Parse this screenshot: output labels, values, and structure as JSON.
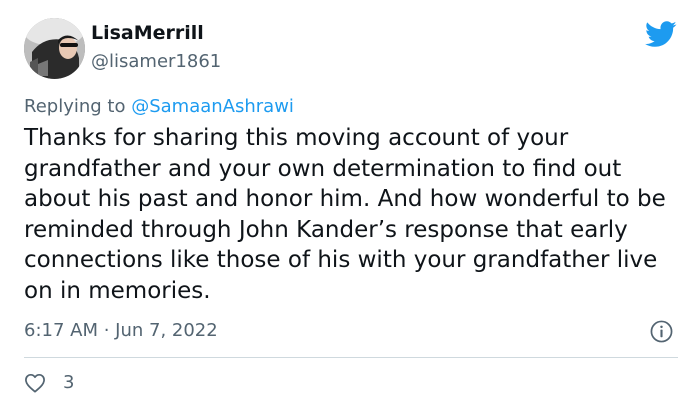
{
  "author": {
    "display_name": "LisaMerrill",
    "handle": "@lisamer1861"
  },
  "reply": {
    "prefix": "Replying to ",
    "mention": "@SamaanAshrawi"
  },
  "tweet": {
    "text": "Thanks for sharing this moving account of your grandfather and your own determination to find out about his past and honor him. And how wonderful to be reminded through John Kander’s response that early connections like those of his with your grandfather live on in memories.",
    "timestamp": "6:17 AM · Jun 7, 2022"
  },
  "engagement": {
    "likes": "3"
  },
  "icons": {
    "brand": "twitter-bird-icon",
    "info": "info-icon",
    "like": "heart-icon"
  },
  "colors": {
    "brand_blue": "#1d9bf0",
    "secondary_text": "#536471",
    "primary_text": "#0f1419",
    "divider": "#cfd9de"
  }
}
